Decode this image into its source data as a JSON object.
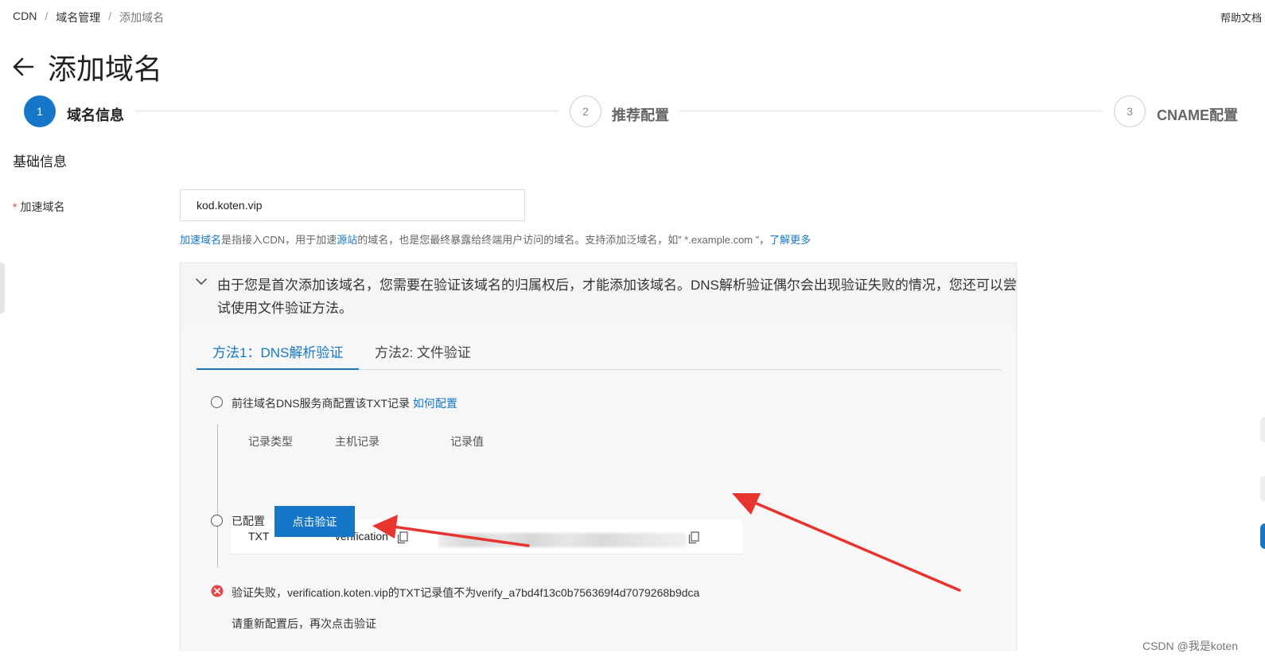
{
  "breadcrumb": {
    "item1": "CDN",
    "item2": "域名管理",
    "item3": "添加域名",
    "sep": "/"
  },
  "help_link": "帮助文档",
  "page_title": "添加域名",
  "steps": [
    {
      "number": "1",
      "label": "域名信息"
    },
    {
      "number": "2",
      "label": "推荐配置"
    },
    {
      "number": "3",
      "label": "CNAME配置"
    }
  ],
  "section_title": "基础信息",
  "field": {
    "required_mark": "*",
    "label": "加速域名",
    "value": "kod.koten.vip"
  },
  "hint": {
    "link1": "加速域名",
    "text1": "是指接入CDN，用于加速",
    "link2": "源站",
    "text2": "的域名，也是您最终暴露给终端用户访问的域名。支持添加泛域名，如” *.example.com ”，",
    "link3": "了解更多"
  },
  "verify": {
    "message": "由于您是首次添加该域名，您需要在验证该域名的归属权后，才能添加该域名。DNS解析验证偶尔会出现验证失败的情况，您还可以尝试使用文件验证方法。",
    "tabs": [
      "方法1：DNS解析验证",
      "方法2: 文件验证"
    ],
    "option1_text": "前往域名DNS服务商配置该TXT记录",
    "option1_link": "如何配置",
    "record_headers": [
      "记录类型",
      "主机记录",
      "记录值"
    ],
    "record": {
      "type": "TXT",
      "host": "verification"
    },
    "option2_text": "已配置",
    "verify_button": "点击验证",
    "error_text": "验证失败，verification.koten.vip的TXT记录值不为verify_a7bd4f13c0b756369f4d7079268b9dca",
    "retry_text": "请重新配置后，再次点击验证"
  },
  "watermark": "CSDN @我是koten",
  "colors": {
    "accent": "#1677c9",
    "error": "#e8474a",
    "annotation_arrow": "#e8342f"
  }
}
